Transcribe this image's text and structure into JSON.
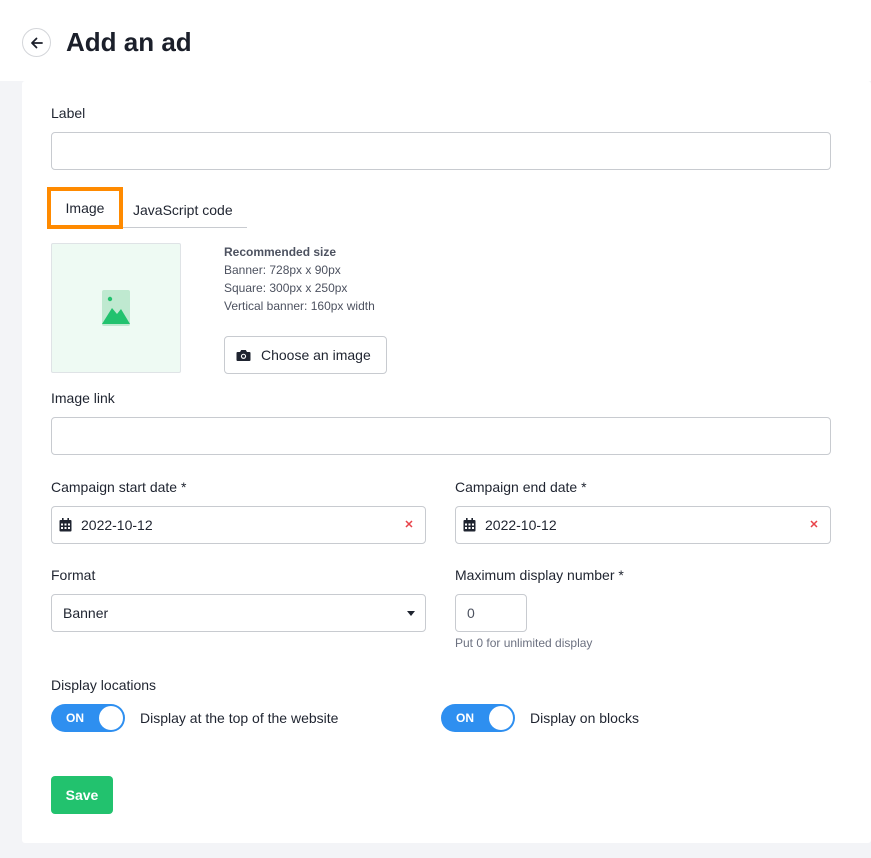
{
  "header": {
    "title": "Add an ad",
    "back_icon": "arrow-left-icon"
  },
  "form": {
    "label_field": {
      "label": "Label",
      "value": "",
      "placeholder": ""
    },
    "tabs": [
      {
        "label": "Image",
        "selected": true
      },
      {
        "label": "JavaScript code",
        "selected": false
      }
    ],
    "image_upload": {
      "placeholder_icon": "image-icon",
      "recommended_title": "Recommended size",
      "recommended_lines": [
        "Banner: 728px x 90px",
        "Square: 300px x 250px",
        "Vertical banner: 160px width"
      ],
      "choose_button_label": "Choose an image",
      "choose_button_icon": "camera-icon"
    },
    "image_link": {
      "label": "Image link",
      "value": "",
      "placeholder": ""
    },
    "start_date": {
      "label": "Campaign start date *",
      "value": "2022-10-12",
      "icon": "calendar-icon",
      "clear_icon": "close-icon"
    },
    "end_date": {
      "label": "Campaign end date *",
      "value": "2022-10-12",
      "icon": "calendar-icon",
      "clear_icon": "close-icon"
    },
    "format": {
      "label": "Format",
      "selected": "Banner"
    },
    "max_display": {
      "label": "Maximum display number *",
      "value": "0",
      "hint": "Put 0 for unlimited display"
    },
    "display_locations": {
      "label": "Display locations",
      "toggles": [
        {
          "state_label": "ON",
          "label": "Display at the top of the website",
          "on": true
        },
        {
          "state_label": "ON",
          "label": "Display on blocks",
          "on": true
        }
      ]
    },
    "save_label": "Save"
  },
  "colors": {
    "accent_blue": "#2e8ff0",
    "save_green": "#22c26e",
    "highlight_orange": "#ff8a00",
    "clear_red": "#e8434a"
  }
}
